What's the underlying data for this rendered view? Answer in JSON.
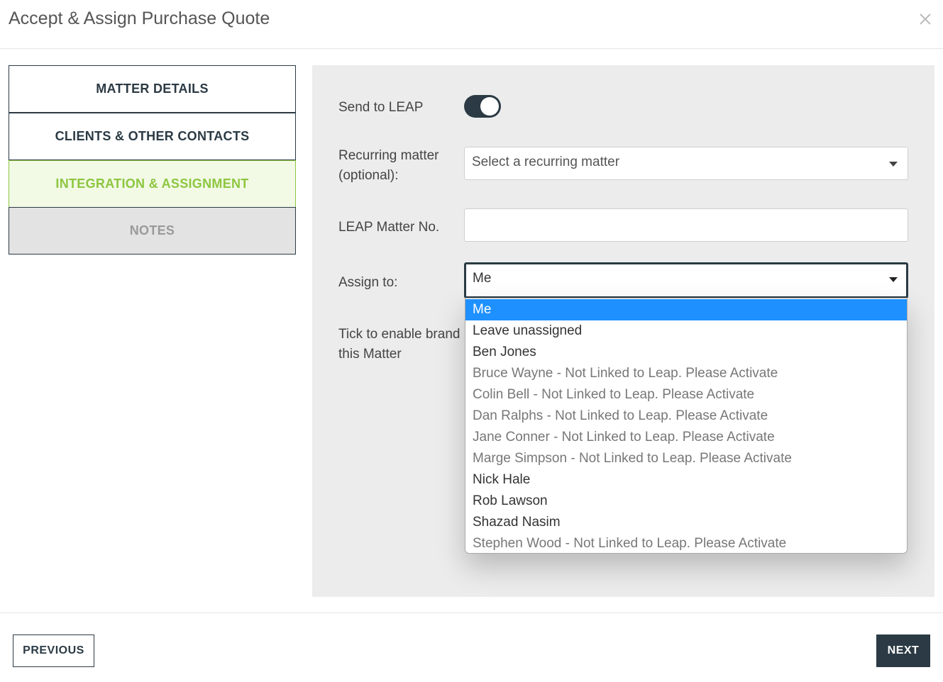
{
  "modal": {
    "title": "Accept & Assign Purchase Quote",
    "close_icon": "close-icon"
  },
  "steps": [
    {
      "label": "MATTER DETAILS",
      "state": "default"
    },
    {
      "label": "CLIENTS & OTHER CONTACTS",
      "state": "default"
    },
    {
      "label": "INTEGRATION & ASSIGNMENT",
      "state": "active"
    },
    {
      "label": "NOTES",
      "state": "disabled"
    }
  ],
  "form": {
    "send_to_leap": {
      "label": "Send to LEAP",
      "checked": true
    },
    "recurring_matter": {
      "label_line1": "Recurring matter",
      "label_line2": "(optional):",
      "placeholder": "Select a recurring matter"
    },
    "leap_matter_no": {
      "label": "LEAP Matter No.",
      "value": ""
    },
    "assign_to": {
      "label": "Assign to:",
      "selected": "Me",
      "options": [
        {
          "label": "Me",
          "selected": true,
          "linked": true
        },
        {
          "label": "Leave unassigned",
          "selected": false,
          "linked": true
        },
        {
          "label": "Ben Jones",
          "selected": false,
          "linked": true
        },
        {
          "label": "Bruce Wayne - Not Linked to Leap. Please Activate",
          "selected": false,
          "linked": false
        },
        {
          "label": "Colin Bell - Not Linked to Leap. Please Activate",
          "selected": false,
          "linked": false
        },
        {
          "label": "Dan Ralphs - Not Linked to Leap. Please Activate",
          "selected": false,
          "linked": false
        },
        {
          "label": "Jane Conner - Not Linked to Leap. Please Activate",
          "selected": false,
          "linked": false
        },
        {
          "label": "Marge Simpson - Not Linked to Leap. Please Activate",
          "selected": false,
          "linked": false
        },
        {
          "label": "Nick Hale",
          "selected": false,
          "linked": true
        },
        {
          "label": "Rob Lawson",
          "selected": false,
          "linked": true
        },
        {
          "label": "Shazad Nasim",
          "selected": false,
          "linked": true
        },
        {
          "label": "Stephen Wood - Not Linked to Leap. Please Activate",
          "selected": false,
          "linked": false
        }
      ]
    },
    "branding": {
      "label_line1": "Tick to enable brand",
      "label_line2": "this Matter"
    }
  },
  "footer": {
    "previous_label": "PREVIOUS",
    "next_label": "NEXT"
  },
  "colors": {
    "primary": "#2b3a44",
    "active_step": "#8dc63f",
    "active_step_bg": "#f2f9e5",
    "selected_option": "#1e90ff",
    "panel_bg": "#ececec"
  }
}
